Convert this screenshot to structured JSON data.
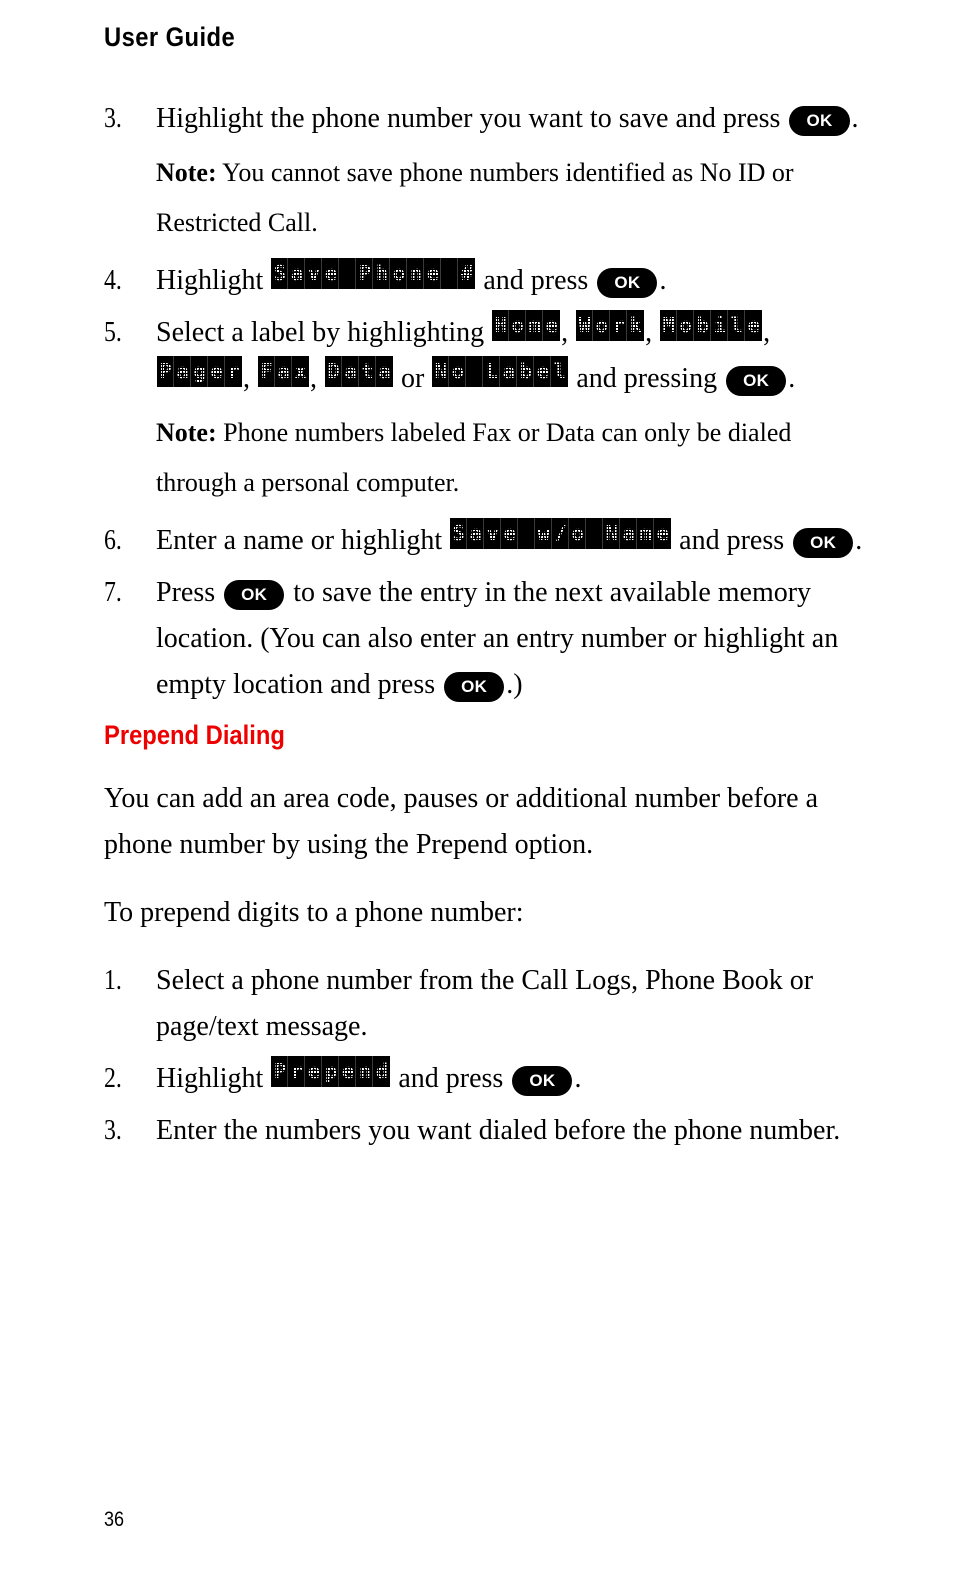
{
  "document": {
    "running_head": "User Guide",
    "page_number": "36",
    "accent_color": "#ee0000",
    "key_label": "OK"
  },
  "blocks": [
    {
      "kind": "step",
      "number": "3.",
      "segments": [
        {
          "type": "text",
          "value": "Highlight the phone number you want to save and press "
        },
        {
          "type": "key",
          "value": "OK"
        },
        {
          "type": "text",
          "value": "."
        }
      ]
    },
    {
      "kind": "note",
      "label": "Note:",
      "text": " You cannot save phone numbers identified as No ID or Restricted Call."
    },
    {
      "kind": "step",
      "number": "4.",
      "segments": [
        {
          "type": "text",
          "value": "Highlight "
        },
        {
          "type": "lcd",
          "value": "Save Phone #"
        },
        {
          "type": "text",
          "value": " and press "
        },
        {
          "type": "key",
          "value": "OK"
        },
        {
          "type": "text",
          "value": "."
        }
      ]
    },
    {
      "kind": "step",
      "number": "5.",
      "segments": [
        {
          "type": "text",
          "value": "Select a label by highlighting "
        },
        {
          "type": "lcd",
          "value": "Home"
        },
        {
          "type": "text",
          "value": ", "
        },
        {
          "type": "lcd",
          "value": "Work"
        },
        {
          "type": "text",
          "value": ", "
        },
        {
          "type": "lcd",
          "value": "Mobile"
        },
        {
          "type": "text",
          "value": ", "
        },
        {
          "type": "lcd",
          "value": "Pager"
        },
        {
          "type": "text",
          "value": ", "
        },
        {
          "type": "lcd",
          "value": "Fax"
        },
        {
          "type": "text",
          "value": ", "
        },
        {
          "type": "lcd",
          "value": "Data"
        },
        {
          "type": "text",
          "value": " or "
        },
        {
          "type": "lcd",
          "value": "No Label"
        },
        {
          "type": "text",
          "value": " and pressing "
        },
        {
          "type": "key",
          "value": "OK"
        },
        {
          "type": "text",
          "value": "."
        }
      ]
    },
    {
      "kind": "note",
      "label": "Note:",
      "text": " Phone numbers labeled Fax or Data can only be dialed through a personal computer."
    },
    {
      "kind": "step",
      "number": "6.",
      "segments": [
        {
          "type": "text",
          "value": "Enter a name or highlight "
        },
        {
          "type": "lcd",
          "value": "Save w/o Name"
        },
        {
          "type": "text",
          "value": " and press "
        },
        {
          "type": "key",
          "value": "OK"
        },
        {
          "type": "text",
          "value": "."
        }
      ]
    },
    {
      "kind": "step",
      "number": "7.",
      "segments": [
        {
          "type": "text",
          "value": "Press "
        },
        {
          "type": "key",
          "value": "OK"
        },
        {
          "type": "text",
          "value": " to save the entry in the next available memory location. (You can also enter an entry number or highlight an empty location and press "
        },
        {
          "type": "key",
          "value": "OK"
        },
        {
          "type": "text",
          "value": ".)"
        }
      ]
    },
    {
      "kind": "heading",
      "text": "Prepend Dialing"
    },
    {
      "kind": "para",
      "segments": [
        {
          "type": "text",
          "value": "You can add an area code, pauses or additional number before a phone number by using the Prepend option."
        }
      ]
    },
    {
      "kind": "para",
      "segments": [
        {
          "type": "text",
          "value": "To prepend digits to a phone number:"
        }
      ]
    },
    {
      "kind": "step",
      "number": "1.",
      "segments": [
        {
          "type": "text",
          "value": "Select a phone number from the Call Logs, Phone Book or page/text message."
        }
      ]
    },
    {
      "kind": "step",
      "number": "2.",
      "segments": [
        {
          "type": "text",
          "value": "Highlight "
        },
        {
          "type": "lcd",
          "value": "Prepend"
        },
        {
          "type": "text",
          "value": " and press "
        },
        {
          "type": "key",
          "value": "OK"
        },
        {
          "type": "text",
          "value": "."
        }
      ]
    },
    {
      "kind": "step",
      "number": "3.",
      "segments": [
        {
          "type": "text",
          "value": "Enter the numbers you want dialed before the phone number."
        }
      ]
    }
  ]
}
